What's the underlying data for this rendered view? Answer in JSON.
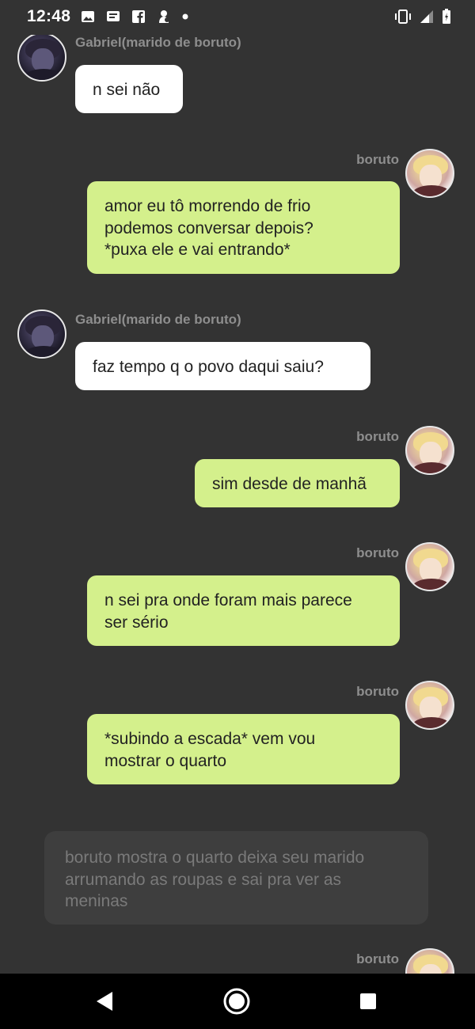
{
  "status_bar": {
    "time": "12:48",
    "left_icons": [
      "image-icon",
      "message-icon",
      "facebook-icon",
      "app-icon",
      "dot-icon"
    ],
    "right_icons": [
      "vibrate-icon",
      "signal-icon",
      "battery-icon"
    ]
  },
  "messages": [
    {
      "sender": "Gabriel(marido de boruto)",
      "side": "left",
      "text": "n sei não"
    },
    {
      "sender": "boruto",
      "side": "right",
      "text": "amor eu tô morrendo de frio\npodemos conversar depois?\n*puxa ele e vai entrando*"
    },
    {
      "sender": "Gabriel(marido de boruto)",
      "side": "left",
      "text": "faz tempo q o povo daqui  saiu?"
    },
    {
      "sender": "boruto",
      "side": "right",
      "text": "sim desde de manhã"
    },
    {
      "sender": "boruto",
      "side": "right",
      "text": "n sei pra  onde foram mais parece\nser sério"
    },
    {
      "sender": "boruto",
      "side": "right",
      "text": "*subindo a escada* vem vou\nmostrar o quarto"
    },
    {
      "sender": "boruto",
      "side": "right",
      "text": ""
    }
  ],
  "narration": "boruto mostra o quarto deixa seu marido\narrumando as roupas e sai pra ver as\nmeninas",
  "colors": {
    "background": "#333333",
    "bubble_left": "#ffffff",
    "bubble_right": "#d4f08c",
    "narration_bg": "#3e3e3e"
  },
  "nav_bar": {
    "buttons": [
      "back-icon",
      "home-icon",
      "recents-icon"
    ]
  }
}
